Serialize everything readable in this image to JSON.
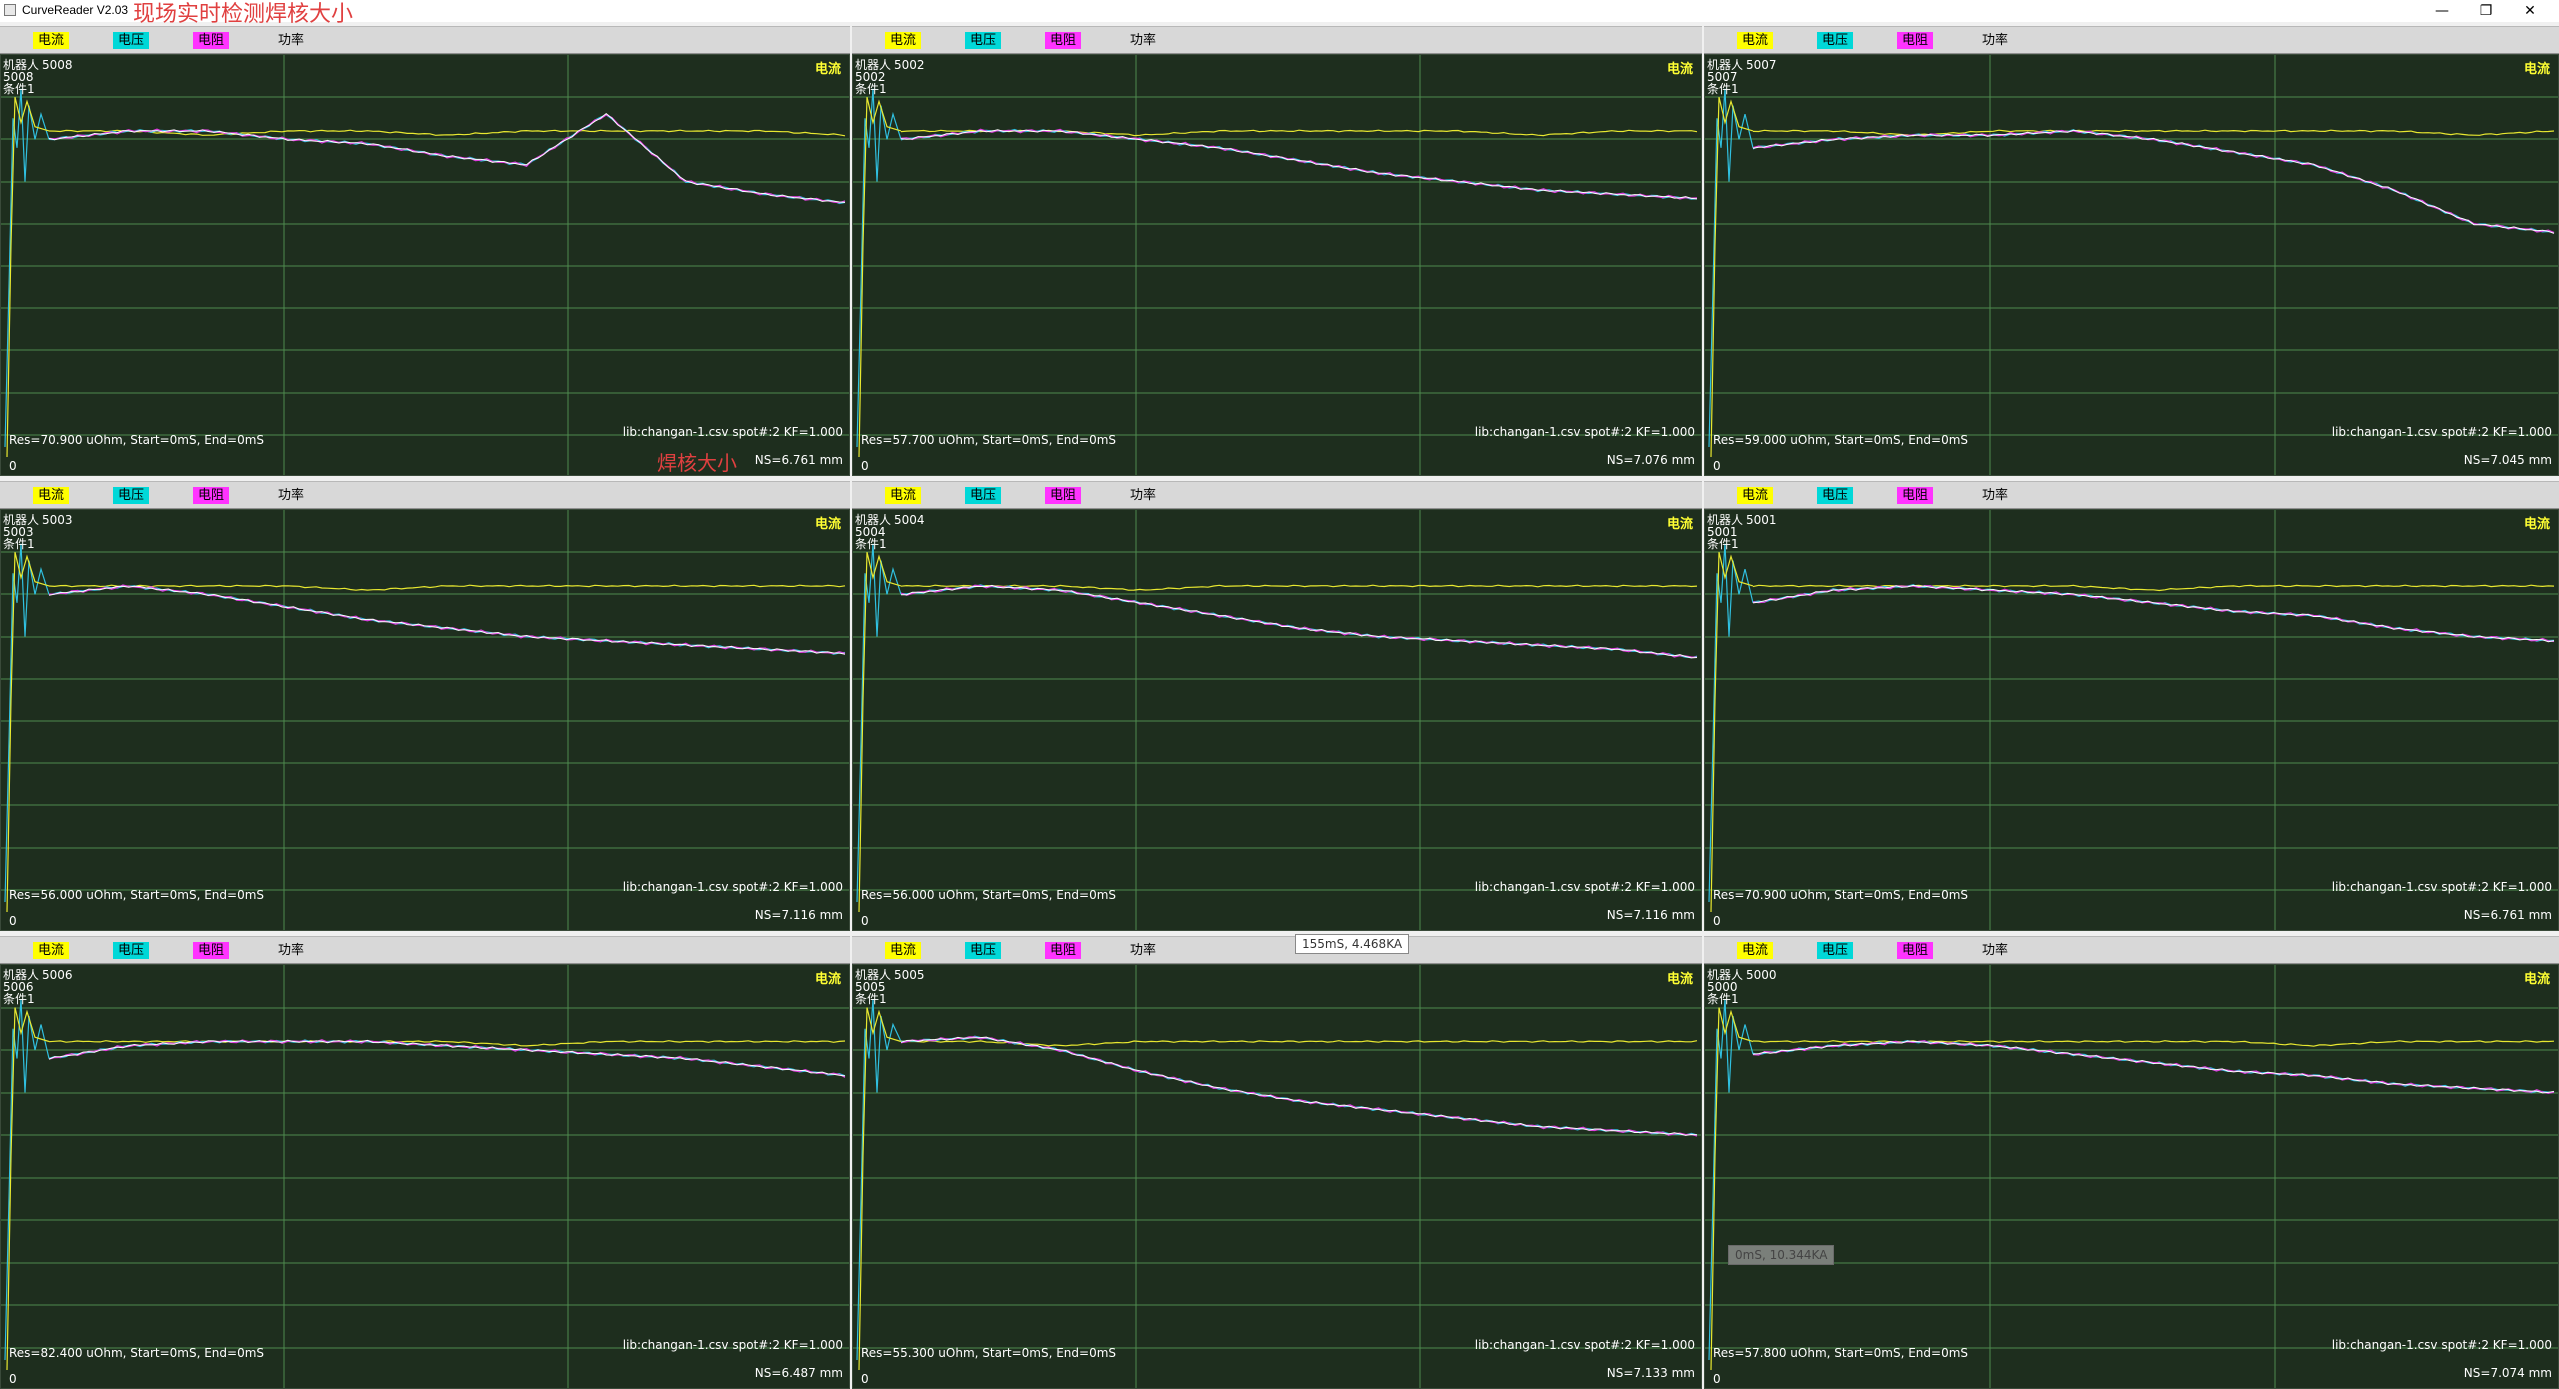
{
  "window": {
    "app_title": "CurveReader V2.03",
    "overlay_title": "现场实时检测焊核大小",
    "buttons": {
      "minimize": "—",
      "maximize": "❐",
      "close": "✕"
    }
  },
  "legend": [
    {
      "label": "电流",
      "color": "#ffff00"
    },
    {
      "label": "电压",
      "color": "#00d8d8"
    },
    {
      "label": "电阻",
      "color": "#ff33ff"
    },
    {
      "label": "功率",
      "color": "#ffffff"
    }
  ],
  "colors": {
    "plot_bg": "#1e2e1e",
    "grid": "#4e8a4e",
    "current": "#e8e830",
    "res_white": "#ffffff",
    "res_magenta": "#e040e0",
    "res_cyan": "#30c0e0"
  },
  "machine_label_prefix": "机器人",
  "condition_label": "条件1",
  "channel_label": "电流",
  "annotation": "焊核大小",
  "tooltips": {
    "middle": "155mS, 4.468KA",
    "bottom_right": "0mS, 10.344KA"
  },
  "chart_data": [
    {
      "type": "line",
      "id": "5008",
      "res": "Res=70.900 uOhm, Start=0mS, End=0mS",
      "lib": "lib:changan-1.csv spot#:2 KF=1.000",
      "ns": "NS=6.761 mm",
      "zero": "0",
      "series": [
        {
          "name": "电流",
          "y": [
            0.82,
            0.82,
            0.81,
            0.82,
            0.82,
            0.81,
            0.82,
            0.82,
            0.82,
            0.82,
            0.81
          ]
        },
        {
          "name": "电阻",
          "y": [
            0.8,
            0.82,
            0.82,
            0.8,
            0.79,
            0.76,
            0.74,
            0.86,
            0.7,
            0.67,
            0.65
          ]
        }
      ]
    },
    {
      "type": "line",
      "id": "5002",
      "res": "Res=57.700 uOhm, Start=0mS, End=0mS",
      "lib": "lib:changan-1.csv spot#:2 KF=1.000",
      "ns": "NS=7.076 mm",
      "zero": "0",
      "series": [
        {
          "name": "电流",
          "y": [
            0.82,
            0.82,
            0.82,
            0.81,
            0.82,
            0.82,
            0.82,
            0.82,
            0.81,
            0.82,
            0.82
          ]
        },
        {
          "name": "电阻",
          "y": [
            0.8,
            0.82,
            0.82,
            0.8,
            0.78,
            0.75,
            0.72,
            0.7,
            0.68,
            0.67,
            0.66
          ]
        }
      ]
    },
    {
      "type": "line",
      "id": "5007",
      "res": "Res=59.000 uOhm, Start=0mS, End=0mS",
      "lib": "lib:changan-1.csv spot#:2 KF=1.000",
      "ns": "NS=7.045 mm",
      "zero": "0",
      "series": [
        {
          "name": "电流",
          "y": [
            0.82,
            0.82,
            0.81,
            0.82,
            0.82,
            0.82,
            0.82,
            0.82,
            0.82,
            0.81,
            0.82
          ]
        },
        {
          "name": "电阻",
          "y": [
            0.78,
            0.8,
            0.81,
            0.81,
            0.82,
            0.8,
            0.77,
            0.74,
            0.68,
            0.6,
            0.58
          ]
        }
      ]
    },
    {
      "type": "line",
      "id": "5003",
      "res": "Res=56.000 uOhm, Start=0mS, End=0mS",
      "lib": "lib:changan-1.csv spot#:2 KF=1.000",
      "ns": "NS=7.116 mm",
      "zero": "0",
      "series": [
        {
          "name": "电流",
          "y": [
            0.82,
            0.82,
            0.82,
            0.82,
            0.81,
            0.82,
            0.82,
            0.82,
            0.82,
            0.82,
            0.82
          ]
        },
        {
          "name": "电阻",
          "y": [
            0.8,
            0.82,
            0.8,
            0.77,
            0.74,
            0.72,
            0.7,
            0.69,
            0.68,
            0.67,
            0.66
          ]
        }
      ]
    },
    {
      "type": "line",
      "id": "5004",
      "res": "Res=56.000 uOhm, Start=0mS, End=0mS",
      "lib": "lib:changan-1.csv spot#:2 KF=1.000",
      "ns": "NS=7.116 mm",
      "zero": "0",
      "series": [
        {
          "name": "电流",
          "y": [
            0.82,
            0.82,
            0.82,
            0.81,
            0.82,
            0.82,
            0.82,
            0.82,
            0.82,
            0.82,
            0.82
          ]
        },
        {
          "name": "电阻",
          "y": [
            0.8,
            0.82,
            0.81,
            0.78,
            0.75,
            0.72,
            0.7,
            0.69,
            0.68,
            0.67,
            0.65
          ]
        }
      ]
    },
    {
      "type": "line",
      "id": "5001",
      "res": "Res=70.900 uOhm, Start=0mS, End=0mS",
      "lib": "lib:changan-1.csv spot#:2 KF=1.000",
      "ns": "NS=6.761 mm",
      "zero": "0",
      "series": [
        {
          "name": "电流",
          "y": [
            0.82,
            0.82,
            0.82,
            0.82,
            0.82,
            0.81,
            0.82,
            0.82,
            0.82,
            0.82,
            0.82
          ]
        },
        {
          "name": "电阻",
          "y": [
            0.78,
            0.81,
            0.82,
            0.81,
            0.8,
            0.78,
            0.76,
            0.75,
            0.72,
            0.7,
            0.69
          ]
        }
      ]
    },
    {
      "type": "line",
      "id": "5006",
      "res": "Res=82.400 uOhm, Start=0mS, End=0mS",
      "lib": "lib:changan-1.csv spot#:2 KF=1.000",
      "ns": "NS=6.487 mm",
      "zero": "0",
      "series": [
        {
          "name": "电流",
          "y": [
            0.82,
            0.82,
            0.82,
            0.82,
            0.82,
            0.82,
            0.81,
            0.82,
            0.82,
            0.82,
            0.82
          ]
        },
        {
          "name": "电阻",
          "y": [
            0.78,
            0.81,
            0.82,
            0.82,
            0.82,
            0.81,
            0.8,
            0.79,
            0.78,
            0.76,
            0.74
          ]
        }
      ]
    },
    {
      "type": "line",
      "id": "5005",
      "res": "Res=55.300 uOhm, Start=0mS, End=0mS",
      "lib": "lib:changan-1.csv spot#:2 KF=1.000",
      "ns": "NS=7.133 mm",
      "zero": "0",
      "series": [
        {
          "name": "电流",
          "y": [
            0.82,
            0.82,
            0.81,
            0.82,
            0.82,
            0.82,
            0.82,
            0.82,
            0.82,
            0.82,
            0.82
          ]
        },
        {
          "name": "电阻",
          "y": [
            0.82,
            0.83,
            0.8,
            0.75,
            0.71,
            0.68,
            0.66,
            0.64,
            0.62,
            0.61,
            0.6
          ]
        }
      ]
    },
    {
      "type": "line",
      "id": "5000",
      "res": "Res=57.800 uOhm, Start=0mS, End=0mS",
      "lib": "lib:changan-1.csv spot#:2 KF=1.000",
      "ns": "NS=7.074 mm",
      "zero": "0",
      "series": [
        {
          "name": "电流",
          "y": [
            0.82,
            0.82,
            0.82,
            0.82,
            0.82,
            0.82,
            0.82,
            0.81,
            0.82,
            0.82,
            0.82
          ]
        },
        {
          "name": "电阻",
          "y": [
            0.79,
            0.81,
            0.82,
            0.81,
            0.79,
            0.77,
            0.75,
            0.74,
            0.72,
            0.71,
            0.7
          ]
        }
      ]
    }
  ]
}
